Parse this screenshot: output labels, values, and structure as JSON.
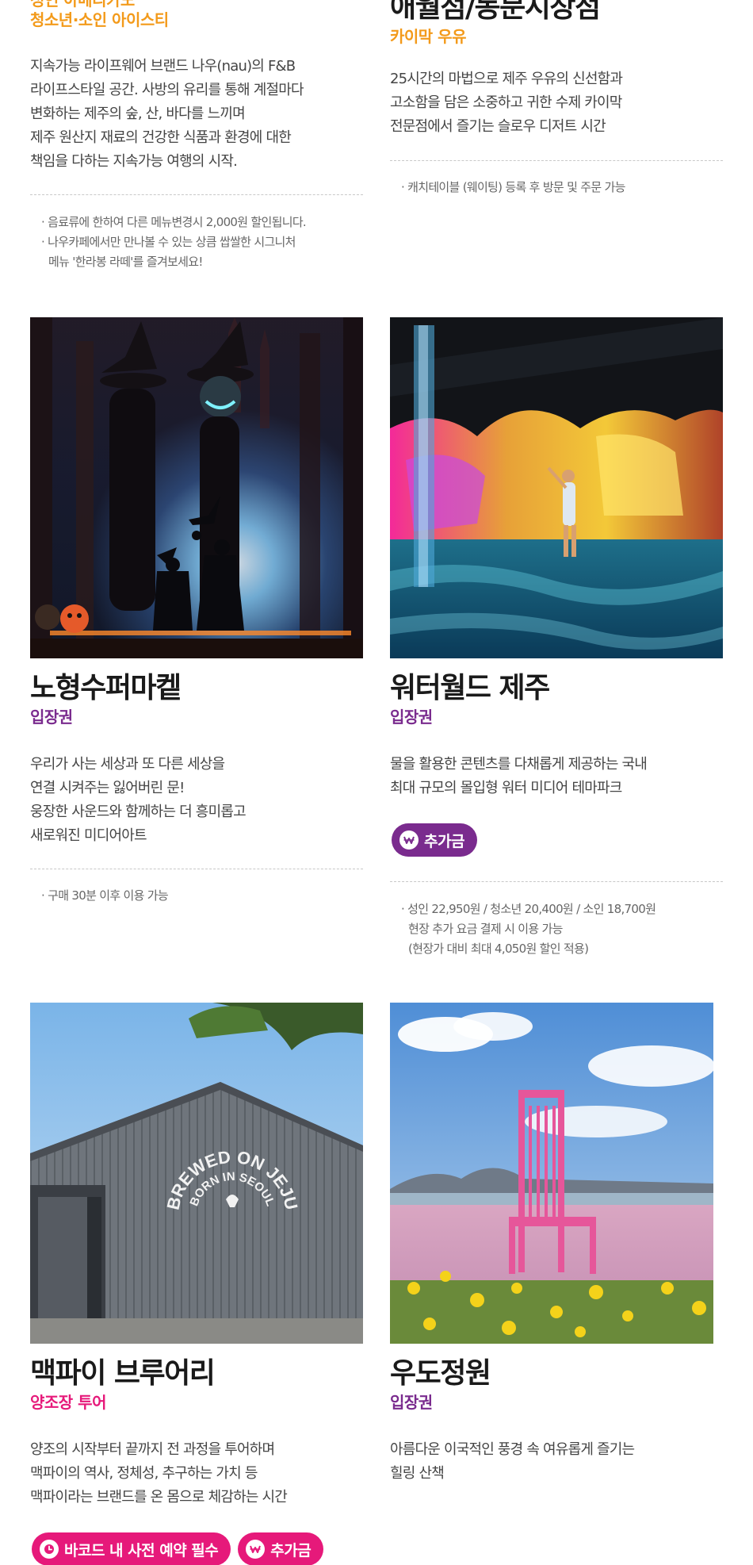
{
  "top": {
    "left": {
      "title_partial_1": "성인 아메리카노",
      "title_partial_2": "청소년·소인 아이스티",
      "desc": [
        "지속가능 라이프웨어 브랜드 나우(nau)의 F&B",
        "라이프스타일 공간. 사방의 유리를 통해 계절마다",
        "변화하는 제주의 숲, 산, 바다를 느끼며",
        "제주 원산지 재료의 건강한 식품과 환경에 대한",
        "책임을 다하는 지속가능 여행의 시작."
      ],
      "notes": [
        "· 음료류에 한하여 다른 메뉴변경시 2,000원 할인됩니다.",
        "· 나우카페에서만 만나볼 수 있는 상큼 쌉쌀한 시그니처",
        "메뉴 '한라봉 라떼'를 즐겨보세요!"
      ]
    },
    "right": {
      "title": "애월점/동문시장점",
      "subtitle": "카이막 우유",
      "desc": [
        "25시간의 마법으로 제주 우유의 신선함과",
        "고소함을 담은 소중하고 귀한 수제 카이막",
        "전문점에서 즐기는 슬로우 디저트 시간"
      ],
      "notes": [
        "· 캐치테이블 (웨이팅) 등록 후 방문 및 주문 가능"
      ]
    }
  },
  "middle": {
    "left": {
      "title": "노형수퍼마켙",
      "subtitle": "입장권",
      "desc": [
        "우리가 사는 세상과 또 다른 세상을",
        "연결 시켜주는 잃어버린 문!",
        "웅장한 사운드와 함께하는 더 흥미롭고",
        "새로워진 미디어아트"
      ],
      "notes": [
        "· 구매 30분 이후 이용 가능"
      ]
    },
    "right": {
      "title": "워터월드 제주",
      "subtitle": "입장권",
      "desc": [
        "물을 활용한 콘텐츠를 다채롭게 제공하는 국내",
        "최대 규모의 몰입형 워터 미디어 테마파크"
      ],
      "tag": "추가금",
      "notes": [
        "· 성인 22,950원 / 청소년 20,400원 / 소인 18,700원",
        "현장 추가 요금 결제 시 이용 가능",
        "(현장가 대비 최대 4,050원 할인 적용)"
      ]
    }
  },
  "bottom": {
    "left": {
      "title": "맥파이 브루어리",
      "subtitle": "양조장 투어",
      "desc": [
        "양조의 시작부터 끝까지 전 과정을 투어하며",
        "맥파이의 역사, 정체성, 추구하는 가치 등",
        "맥파이라는 브랜드를 온 몸으로 체감하는 시간"
      ],
      "tags": [
        "바코드 내 사전 예약 필수",
        "추가금"
      ],
      "wall_text_outer": "BREWED ON JEJU",
      "wall_text_inner": "BORN IN SEOUL"
    },
    "right": {
      "title": "우도정원",
      "subtitle": "입장권",
      "desc": [
        "아름다운 이국적인 풍경 속 여유롭게 즐기는",
        "힐링 산책"
      ]
    }
  },
  "colors": {
    "orange": "#f39a1a",
    "purple": "#7a2b8e",
    "pink": "#e6197a",
    "divider": "#c8c8c8"
  },
  "icons": {
    "surcharge": "won-coin-icon",
    "reservation": "clock-icon"
  }
}
